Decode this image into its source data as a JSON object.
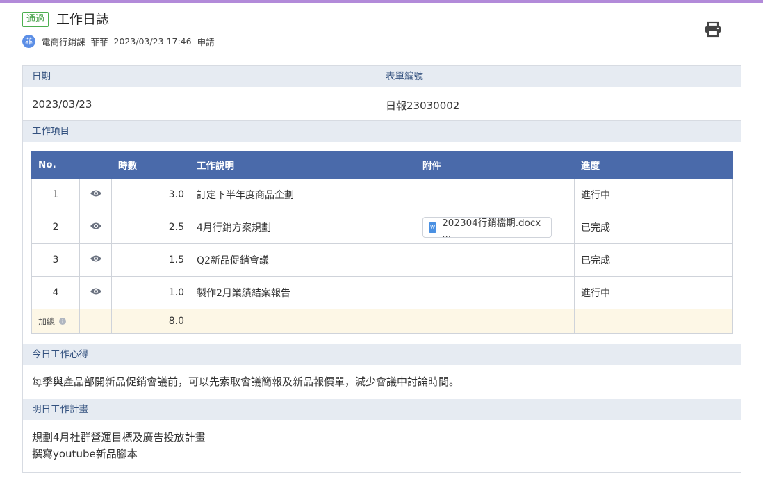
{
  "header": {
    "status_badge": "通過",
    "title": "工作日誌",
    "avatar_text": "菲",
    "department": "電商行銷課",
    "applicant": "菲菲",
    "datetime": "2023/03/23 17:46",
    "action": "申請",
    "print_icon": "printer-icon"
  },
  "form": {
    "date_label": "日期",
    "date_value": "2023/03/23",
    "form_no_label": "表單編號",
    "form_no_value": "日報23030002"
  },
  "work_items": {
    "section_title": "工作項目",
    "columns": [
      "No.",
      "",
      "時數",
      "工作說明",
      "附件",
      "進度"
    ],
    "rows": [
      {
        "no": "1",
        "hours": "3.0",
        "desc": "訂定下半年度商品企劃",
        "attachment": "",
        "progress": "進行中"
      },
      {
        "no": "2",
        "hours": "2.5",
        "desc": "4月行銷方案規劃",
        "attachment": "202304行銷檔期.docx ...",
        "progress": "已完成"
      },
      {
        "no": "3",
        "hours": "1.5",
        "desc": "Q2新品促銷會議",
        "attachment": "",
        "progress": "已完成"
      },
      {
        "no": "4",
        "hours": "1.0",
        "desc": "製作2月業績結案報告",
        "attachment": "",
        "progress": "進行中"
      }
    ],
    "total_label": "加總",
    "total_hours": "8.0"
  },
  "today": {
    "section_title": "今日工作心得",
    "text": "每季與產品部開新品促銷會議前，可以先索取會議簡報及新品報價單，減少會議中討論時間。"
  },
  "tomorrow": {
    "section_title": "明日工作計畫",
    "line1": "規劃4月社群營運目標及廣告投放計畫",
    "line2": "撰寫youtube新品腳本"
  },
  "colors": {
    "accent": "#b28ad9",
    "table_header": "#4a6aaa",
    "section_bg": "#e6ebf2",
    "total_bg": "#fdf7e6",
    "status_green": "#43a047"
  }
}
